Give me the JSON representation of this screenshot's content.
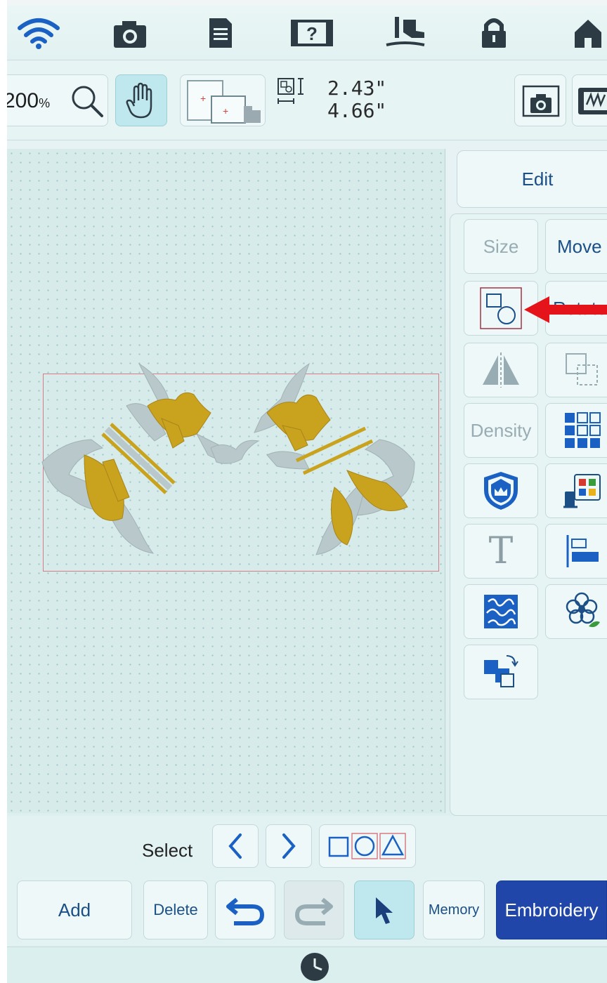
{
  "toolbar": {
    "zoom_value": "200",
    "zoom_unit": "%",
    "height_value": "2.43\"",
    "width_value": "4.66\""
  },
  "side_panel": {
    "edit_tab": "Edit",
    "size_button": "Size",
    "move_button": "Move",
    "rotate_button": "Rotate",
    "density_button": "Density",
    "text_button_glyph": "T"
  },
  "select_bar": {
    "label": "Select"
  },
  "bottom_bar": {
    "add": "Add",
    "delete": "Delete",
    "memory": "Memory",
    "embroidery": "Embroidery"
  },
  "colors": {
    "accent_blue": "#1f46a8",
    "icon_blue": "#1b61c4",
    "thread_gold": "#c9a21e",
    "thread_silver": "#b9c8ca",
    "hoop_frame": "#d77b84",
    "pointer_arrow": "#e5131a"
  },
  "icons": [
    "wifi-icon",
    "camera-icon",
    "document-icon",
    "help-film-icon",
    "presser-foot-icon",
    "lock-icon",
    "home-icon",
    "zoom-icon",
    "hand-icon",
    "hoop-icon",
    "dimension-icon",
    "scan-camera-icon",
    "stitch-display-icon",
    "group-shapes-icon",
    "mirror-icon",
    "duplicate-icon",
    "array-icon",
    "shield-crown-icon",
    "thread-color-icon",
    "text-icon",
    "align-icon",
    "stippling-icon",
    "applique-flower-icon",
    "border-icon",
    "left-arrow-icon",
    "right-arrow-icon",
    "undo-icon",
    "redo-icon",
    "cursor-icon",
    "clock-icon"
  ]
}
